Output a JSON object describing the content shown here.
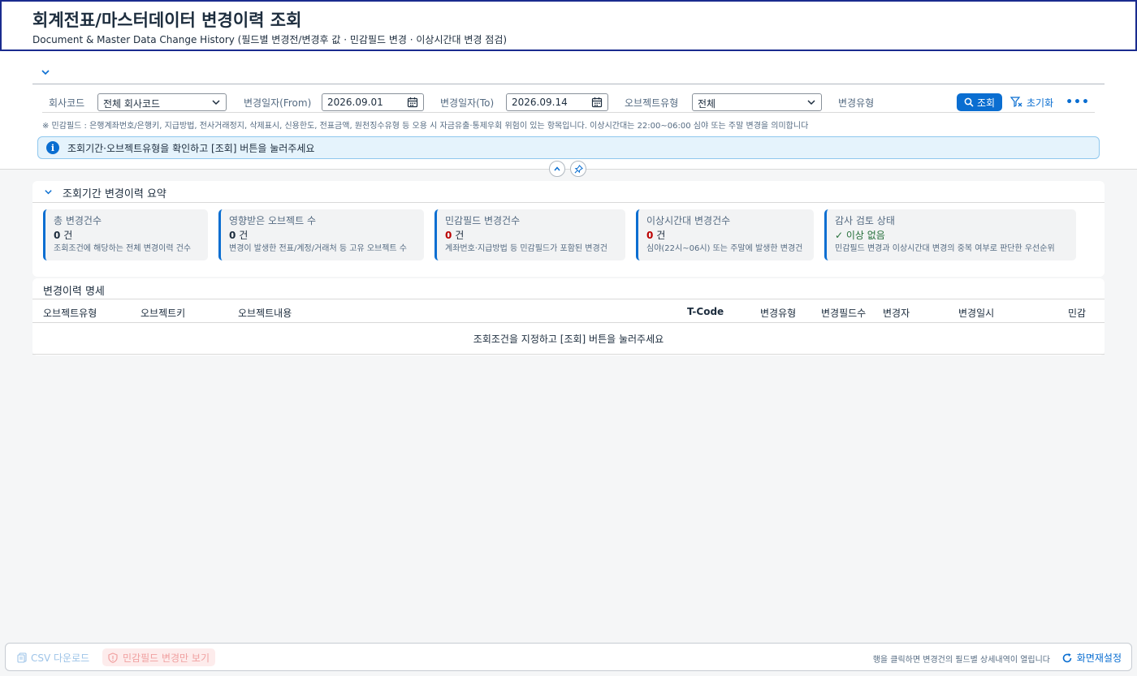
{
  "header": {
    "title": "회계전표/마스터데이터 변경이력 조회",
    "subtitle": "Document & Master Data Change History (필드별 변경전/변경후 값 · 민감필드 변경 · 이상시간대 변경 점검)"
  },
  "filters": {
    "company_label": "회사코드",
    "company_value": "전체 회사코드",
    "from_label": "변경일자(From)",
    "from_value": "2026.09.01",
    "to_label": "변경일자(To)",
    "to_value": "2026.09.14",
    "object_type_label": "오브젝트유형",
    "object_type_value": "전체",
    "change_type_label": "변경유형",
    "search_button": "조회",
    "reset_button": "초기화",
    "more_button": "•••",
    "note": "※ 민감필드 : 은행계좌번호/은행키, 지급방법, 전사거래정지, 삭제표시, 신용한도, 전표금액, 원천징수유형 등 오용 시 자금유출·통제우회 위험이 있는 항목입니다. 이상시간대는 22:00~06:00 심야 또는 주말 변경을 의미합니다"
  },
  "info_message": "조회기간·오브젝트유형을 확인하고 [조회] 버튼을 눌러주세요",
  "summary": {
    "title": "조회기간 변경이력 요약",
    "cards": [
      {
        "label": "총 변경건수",
        "value": "0",
        "unit": "건",
        "desc": "조회조건에 해당하는 전체 변경이력 건수"
      },
      {
        "label": "영향받은 오브젝트 수",
        "value": "0",
        "unit": "건",
        "desc": "변경이 발생한 전표/계정/거래처 등 고유 오브젝트 수"
      },
      {
        "label": "민감필드 변경건수",
        "value": "0",
        "unit": "건",
        "desc": "계좌번호·지급방법 등 민감필드가 포함된 변경건"
      },
      {
        "label": "이상시간대 변경건수",
        "value": "0",
        "unit": "건",
        "desc": "심야(22시~06시) 또는 주말에 발생한 변경건"
      },
      {
        "label": "감사 검토 상태",
        "status": "✓ 이상 없음",
        "desc": "민감필드 변경과 이상시간대 변경의 중복 여부로 판단한 우선순위"
      }
    ]
  },
  "detail": {
    "title": "변경이력 명세",
    "columns": [
      "오브젝트유형",
      "오브젝트키",
      "오브젝트내용",
      "T-Code",
      "변경유형",
      "변경필드수",
      "변경자",
      "변경일시",
      "민감"
    ],
    "empty_text": "조회조건을 지정하고 [조회] 버튼을 눌러주세요"
  },
  "footer": {
    "csv_button": "CSV 다운로드",
    "sensitive_only_button": "민감필드 변경만 보기",
    "hint": "행을 클릭하면 변경건의 필드별 상세내역이 열립니다",
    "refresh_button": "화면재설정"
  },
  "colors": {
    "accent": "#0a6ed1",
    "danger": "#bb0000",
    "success": "#256f3a",
    "header_border": "#1a2b8f"
  }
}
